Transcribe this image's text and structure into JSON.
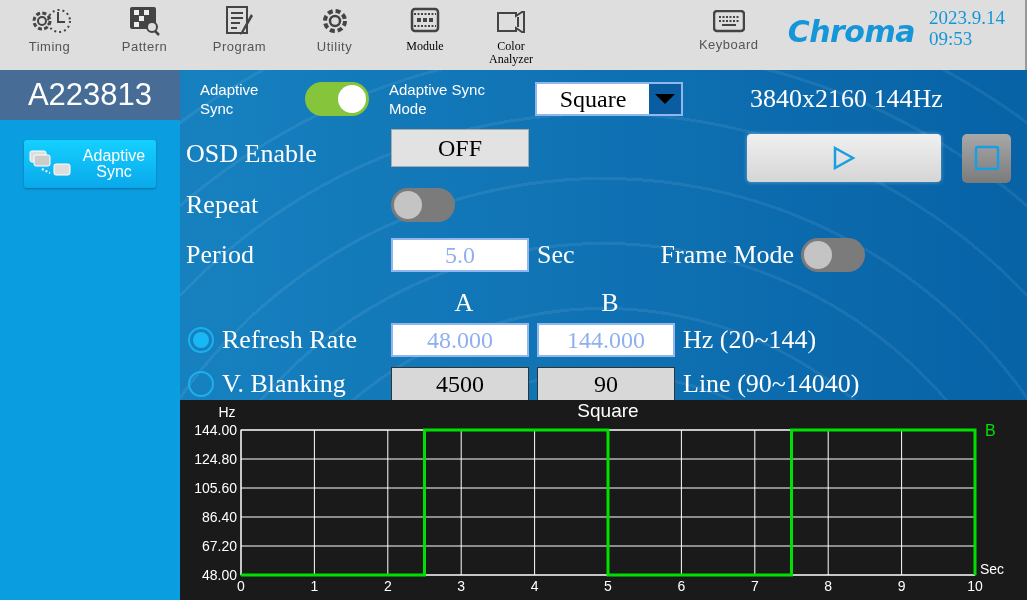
{
  "toolbar": [
    {
      "kind": "timing",
      "label": "Timing"
    },
    {
      "kind": "pattern",
      "label": "Pattern"
    },
    {
      "kind": "program",
      "label": "Program"
    },
    {
      "kind": "utility",
      "label": "Utility"
    },
    {
      "kind": "module",
      "label": "Module"
    },
    {
      "kind": "analyzer",
      "label": "Color Analyzer"
    }
  ],
  "keyboard": {
    "label": "Keyboard"
  },
  "logo": "Chroma",
  "date": "2023.9.14",
  "time": "09:53",
  "sidebar": {
    "title": "A223813",
    "items": [
      {
        "label": "Adaptive Sync",
        "selected": true
      }
    ]
  },
  "adaptive_sync": {
    "label": "Adaptive Sync",
    "on": true
  },
  "mode": {
    "label": "Adaptive Sync Mode",
    "value": "Square"
  },
  "resolution": "3840x2160 144Hz",
  "osd": {
    "label": "OSD Enable",
    "value": "OFF"
  },
  "repeat": {
    "label": "Repeat",
    "on": false
  },
  "period": {
    "label": "Period",
    "value": "5.0",
    "unit": "Sec"
  },
  "frame_mode": {
    "label": "Frame Mode",
    "on": false
  },
  "columns": [
    "A",
    "B"
  ],
  "params": [
    {
      "label": "Refresh Rate",
      "selected": true,
      "editable": true,
      "a": "48.000",
      "b": "144.000",
      "unit": "Hz (20~144)"
    },
    {
      "label": "V. Blanking",
      "selected": false,
      "editable": false,
      "a": "4500",
      "b": "90",
      "unit": "Line (90~14040)"
    }
  ],
  "chart": {
    "chart_data": {
      "type": "line",
      "title": "Square",
      "xlabel": "Sec",
      "ylabel": "Hz",
      "x": [
        0,
        2.5,
        2.5,
        5,
        5,
        7.5,
        7.5,
        10,
        10
      ],
      "series": [
        {
          "name": "B",
          "color": "#00e000",
          "values": [
            48,
            48,
            144,
            144,
            48,
            48,
            144,
            144,
            48
          ]
        }
      ],
      "xlim": [
        0,
        10
      ],
      "ylim": [
        48,
        144
      ],
      "grid": true,
      "xticks": [
        0,
        1,
        2,
        3,
        4,
        5,
        6,
        7,
        8,
        9,
        10
      ],
      "yticks": [
        {
          "value": 48,
          "label": "48.00"
        },
        {
          "value": 67.2,
          "label": "67.20"
        },
        {
          "value": 86.4,
          "label": "86.40"
        },
        {
          "value": 105.6,
          "label": "105.60"
        },
        {
          "value": 124.8,
          "label": "124.80"
        },
        {
          "value": 144,
          "label": "144.00"
        }
      ]
    }
  }
}
